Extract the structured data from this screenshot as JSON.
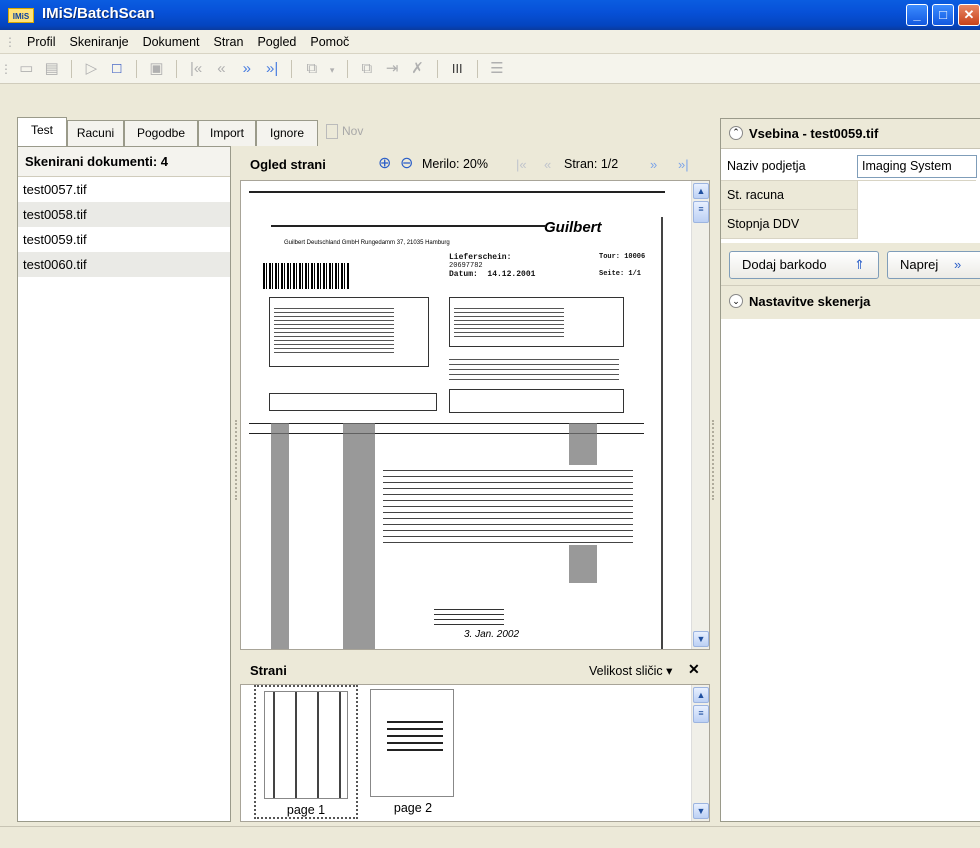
{
  "window": {
    "title": "IMiS/BatchScan",
    "logo": "IMiS"
  },
  "menu": [
    "Profil",
    "Skeniranje",
    "Dokument",
    "Stran",
    "Pogled",
    "Pomoč"
  ],
  "tabs": [
    {
      "label": "Test",
      "active": true
    },
    {
      "label": "Racuni",
      "active": false
    },
    {
      "label": "Pogodbe",
      "active": false
    },
    {
      "label": "Import",
      "active": false
    },
    {
      "label": "Ignore",
      "active": false
    }
  ],
  "new_tab_label": "Nov",
  "documents": {
    "header": "Skenirani dokumenti: 4",
    "items": [
      "test0057.tif",
      "test0058.tif",
      "test0059.tif",
      "test0060.tif"
    ]
  },
  "viewer": {
    "title": "Ogled strani",
    "zoom_label": "Merilo: 20%",
    "page_label": "Stran: 1/2"
  },
  "pages_panel": {
    "title": "Strani",
    "thumb_size_label": "Velikost sličic",
    "pages": [
      "page 1",
      "page 2"
    ]
  },
  "content_panel": {
    "title": "Vsebina - test0059.tif",
    "fields": [
      {
        "label": "Naziv podjetja",
        "value": "Imaging System"
      },
      {
        "label": "St. racuna",
        "value": ""
      },
      {
        "label": "Stopnja DDV",
        "value": ""
      }
    ],
    "add_barcode_label": "Dodaj barkodo",
    "next_label": "Naprej",
    "scan_settings_title": "Nastavitve skenerja"
  },
  "scanned_page": {
    "brand": "Guilbert",
    "company_line": "Guilbert Deutschland GmbH Rungedamm 37, 21035 Hamburg",
    "doc_type": "Lieferschein:",
    "doc_no": "20697782",
    "date": "Datum:  14.12.2001",
    "tour": "Tour: 10006",
    "page": "Seite: 1/1",
    "handwritten_date": "3. Jan. 2002"
  },
  "colors": {
    "titlebar": "#0751d8",
    "panel_bg": "#ece9d8",
    "accent": "#2058c8"
  }
}
